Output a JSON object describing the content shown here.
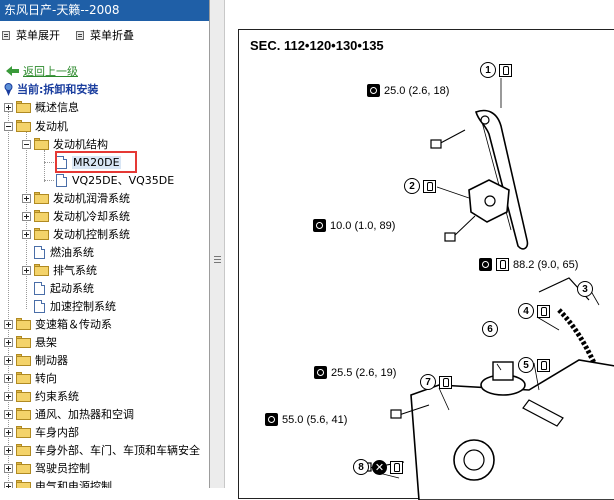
{
  "window": {
    "title": "东风日产-天籁--2008"
  },
  "menu": {
    "expand_label": "菜单展开",
    "collapse_label": "菜单折叠"
  },
  "nav": {
    "back_label": "返回上一级",
    "current_label": "当前:拆卸和安装"
  },
  "tree": {
    "items": [
      {
        "label": "概述信息"
      },
      {
        "label": "发动机"
      },
      {
        "label": "发动机结构"
      },
      {
        "label": "MR20DE"
      },
      {
        "label": "VQ25DE、VQ35DE"
      },
      {
        "label": "发动机润滑系统"
      },
      {
        "label": "发动机冷却系统"
      },
      {
        "label": "发动机控制系统"
      },
      {
        "label": "燃油系统"
      },
      {
        "label": "排气系统"
      },
      {
        "label": "起动系统"
      },
      {
        "label": "加速控制系统"
      },
      {
        "label": "变速箱＆传动系"
      },
      {
        "label": "悬架"
      },
      {
        "label": "制动器"
      },
      {
        "label": "转向"
      },
      {
        "label": "约束系统"
      },
      {
        "label": "通风、加热器和空调"
      },
      {
        "label": "车身内部"
      },
      {
        "label": "车身外部、车门、车顶和车辆安全"
      },
      {
        "label": "驾驶员控制"
      },
      {
        "label": "电气和电源控制"
      }
    ]
  },
  "diagram": {
    "section": "SEC. 112•120•130•135",
    "torques": [
      {
        "text": "25.0 (2.6, 18)"
      },
      {
        "text": "10.0 (1.0, 89)"
      },
      {
        "text": "88.2 (9.0, 65)"
      },
      {
        "text": "25.5 (2.6, 19)"
      },
      {
        "text": "55.0 (5.6, 41)"
      }
    ],
    "callouts": [
      "1",
      "2",
      "3",
      "4",
      "5",
      "6",
      "7",
      "8"
    ]
  },
  "colors": {
    "titlebar": "#1f5fa7",
    "highlight": "#e53935",
    "link": "#2c8a2c",
    "current": "#1a3d9e"
  }
}
